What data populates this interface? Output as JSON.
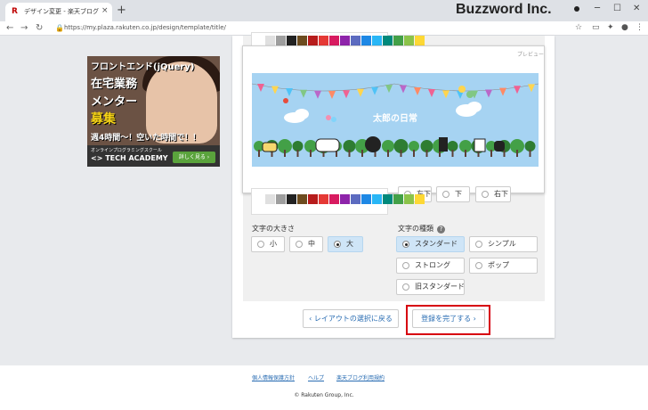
{
  "browser": {
    "tab_title": "デザイン変更 - 楽天ブログ",
    "tab_close": "×",
    "new_tab": "+",
    "brand": "Buzzword Inc.",
    "back": "←",
    "forward": "→",
    "reload": "↻",
    "url": "https://my.plaza.rakuten.co.jp/design/template/title/",
    "min": "─",
    "max": "☐",
    "close": "✕"
  },
  "colors": {
    "swatches": [
      "#ffffff",
      "#e0e0e0",
      "#9e9e9e",
      "#222222",
      "#6d4c1f",
      "#b71c1c",
      "#e53935",
      "#d81b60",
      "#8e24aa",
      "#5c6bc0",
      "#1e88e5",
      "#29b6f6",
      "#00897b",
      "#43a047",
      "#8bc34a",
      "#fdd835"
    ]
  },
  "preview": {
    "label": "プレビュー",
    "title": "太郎の日常"
  },
  "ad": {
    "line1": "フロントエンド(jQuery)",
    "line2": "在宅業務",
    "line3": "メンター",
    "line4": "募集",
    "line5": "週4時間〜！空いた時間で！！",
    "school": "オンラインプログラミングスクール",
    "logo": "<> TECH ACADEMY",
    "cta": "詳しく見る ›"
  },
  "position_row": {
    "left": "左下",
    "center": "下",
    "right": "右下"
  },
  "font_size": {
    "label": "文字の大きさ",
    "options": [
      "小",
      "中",
      "大"
    ],
    "selected": "大"
  },
  "font_type": {
    "label": "文字の種類",
    "help": "?",
    "options": [
      "スタンダード",
      "シンプル",
      "ストロング",
      "ポップ",
      "旧スタンダード"
    ],
    "selected": "スタンダード"
  },
  "actions": {
    "back": "‹ レイアウトの選択に戻る",
    "complete": "登録を完了する ›"
  },
  "footer": {
    "privacy": "個人情報保護方針",
    "help": "ヘルプ",
    "terms": "楽天ブログ利用規約",
    "copyright": "© Rakuten Group, Inc."
  }
}
